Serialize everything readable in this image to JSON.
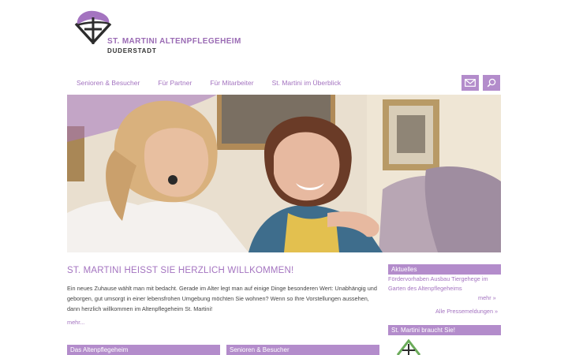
{
  "brand": {
    "name": "St. Martini Altenpflegeheim",
    "subtitle": "Duderstadt",
    "accent_color": "#a474c0",
    "logo_icon": "cross-emblem-icon"
  },
  "nav": {
    "items": [
      {
        "label": "Senioren & Besucher"
      },
      {
        "label": "Für Partner"
      },
      {
        "label": "Für Mitarbeiter"
      },
      {
        "label": "St. Martini im Überblick"
      }
    ],
    "mail_icon": "envelope-icon",
    "search_icon": "search-icon"
  },
  "hero": {
    "image": "photo of a smiling caregiver hugging an elderly woman"
  },
  "main": {
    "headline": "ST. MARTINI HEISST SIE HERZLICH WILLKOMMEN!",
    "intro": "Ein neues Zuhause wählt man mit bedacht. Gerade im Alter legt man auf einige Dinge besonderen Wert: Unabhängig und geborgen, gut umsorgt in einer lebensfrohen Umgebung möchten Sie wohnen? Wenn so Ihre Vorstellungen aussehen, dann herzlich willkommen im Altenpflegeheim St. Martini!",
    "more": "mehr...",
    "boxes": [
      {
        "title": "Das Altenpflegeheim"
      },
      {
        "title": "Senioren & Besucher"
      }
    ]
  },
  "sidebar": {
    "news_title": "Aktuelles",
    "news_item": "Fördervorhaben Ausbau Tiergehege im Garten des Altenpflegeheims",
    "news_more": "mehr »",
    "all_press": "Alle Pressemeldungen »",
    "needs_title": "St. Martini braucht Sie!"
  }
}
